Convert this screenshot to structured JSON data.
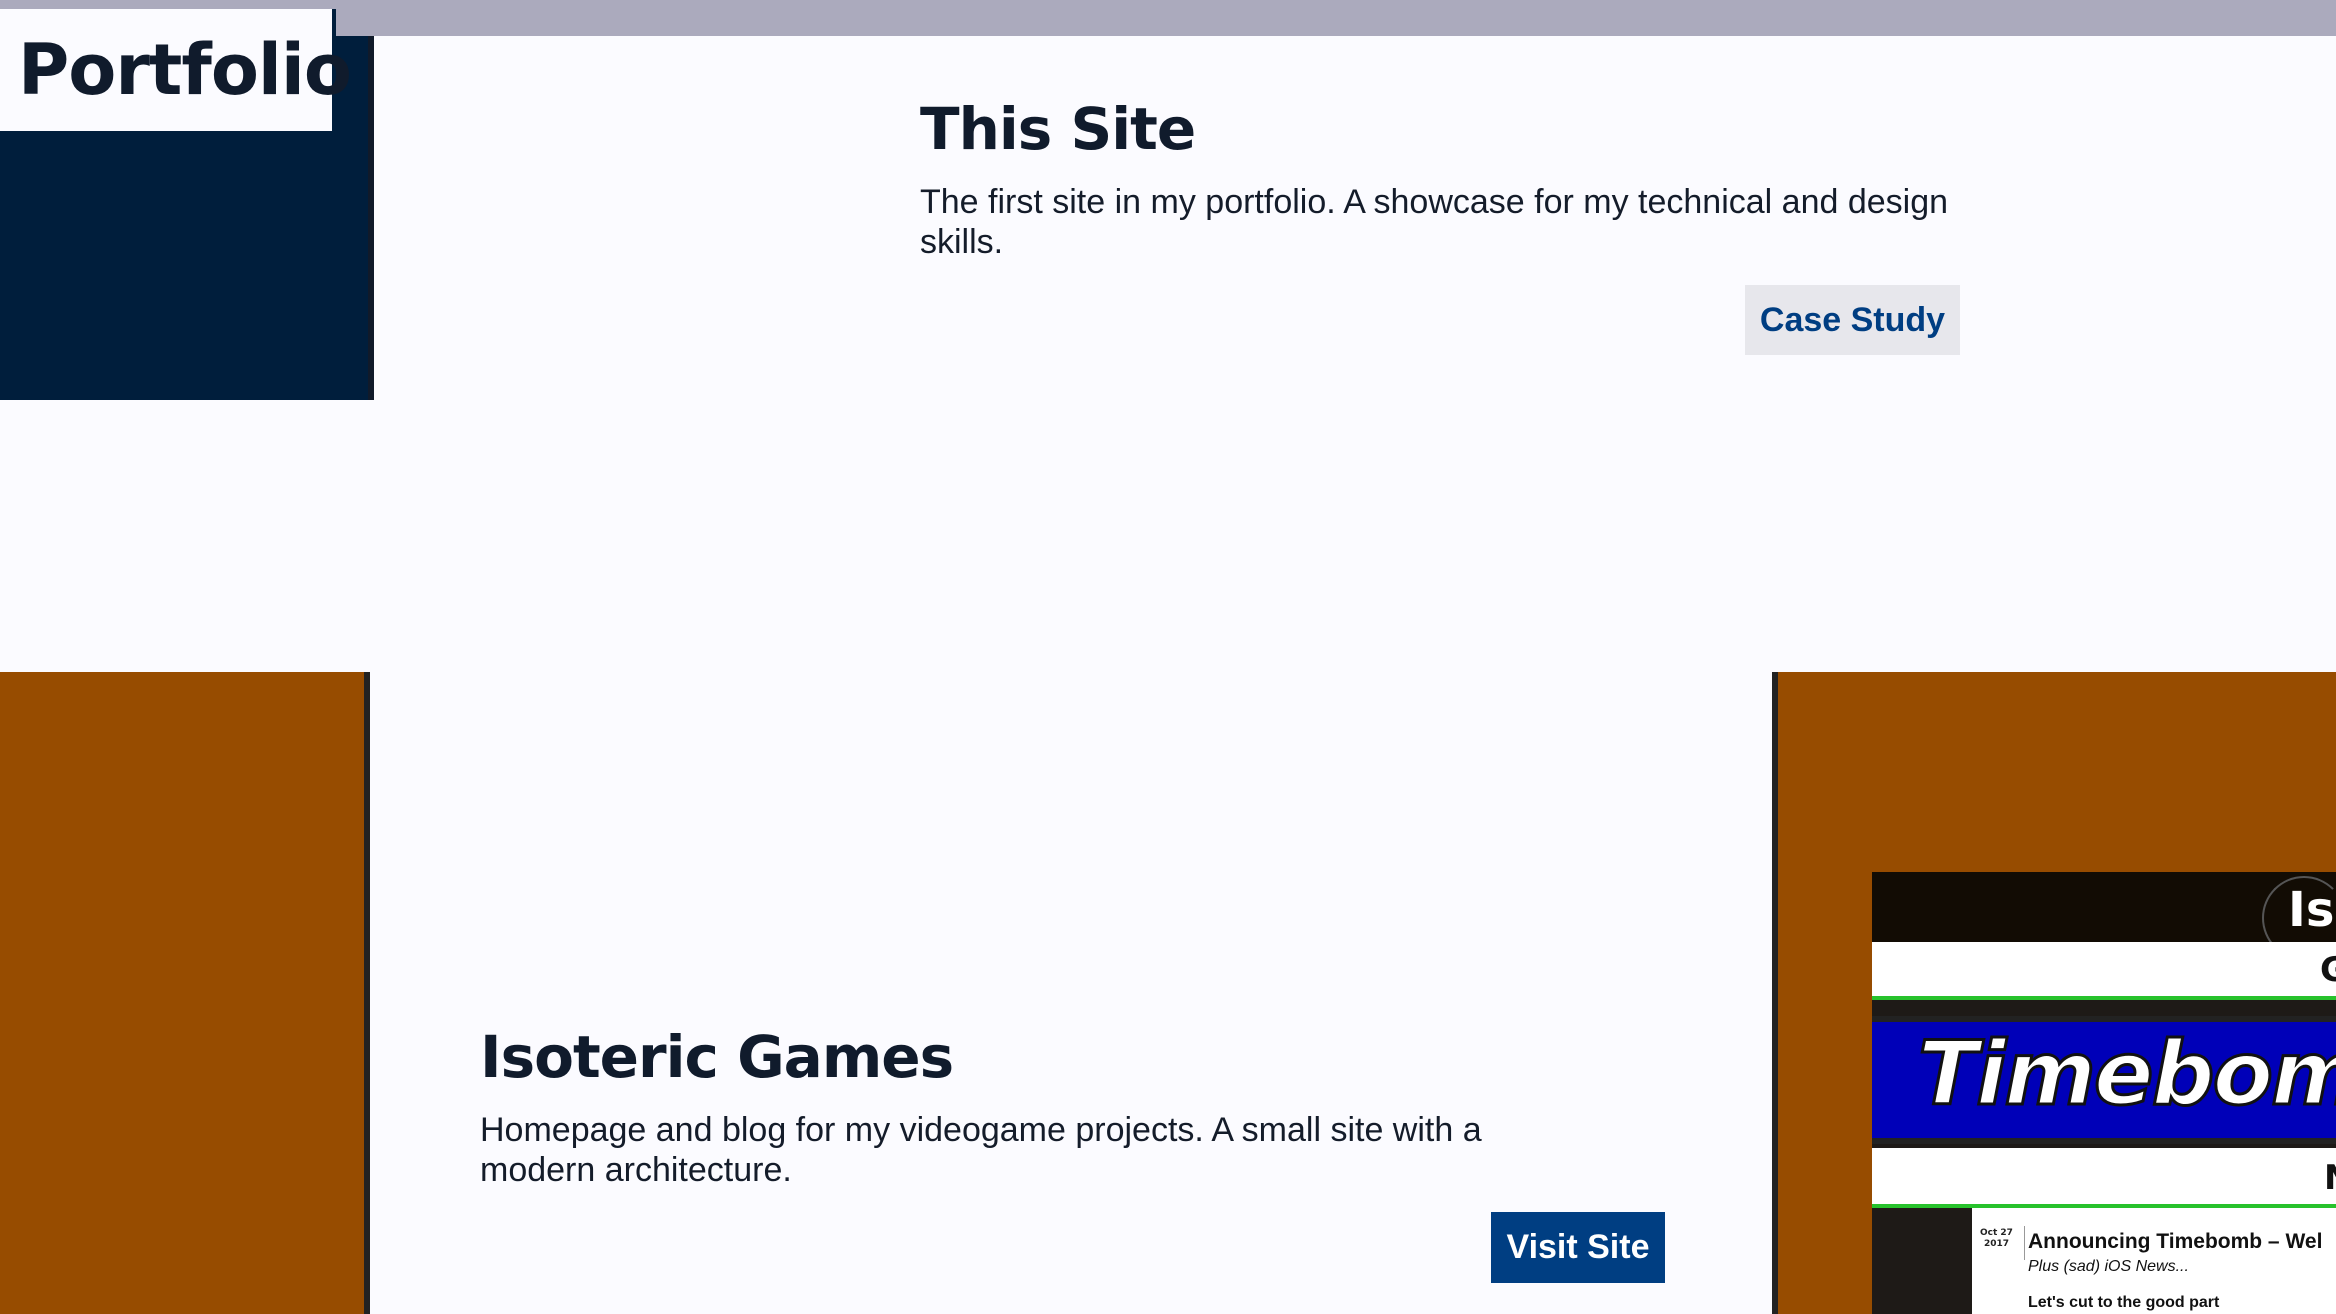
{
  "header": {
    "title": "Portfolio"
  },
  "projects": [
    {
      "title": "This Site",
      "description": "The first site in my portfolio. A showcase for my technical and design skills.",
      "button_label": "Case Study"
    },
    {
      "title": "Isoteric Games",
      "description": "Homepage and blog for my videogame projects. A small site with a modern architecture.",
      "button_label": "Visit Site",
      "screenshot": {
        "logo_text": "Is",
        "nav_text_1": "G",
        "banner_title": "Timebomb",
        "nav_text_2": "N",
        "post_date_month": "Oct 27",
        "post_date_year": "2017",
        "post_title": "Announcing Timebomb – Wel",
        "post_subtitle": "Plus (sad) iOS News...",
        "post_text": "Let's cut to the good part"
      }
    }
  ],
  "colors": {
    "navy": "#001e3c",
    "orange": "#974c00",
    "button_blue": "#003e82",
    "topbar": "#abaabd",
    "page_bg": "#fbfbff"
  }
}
